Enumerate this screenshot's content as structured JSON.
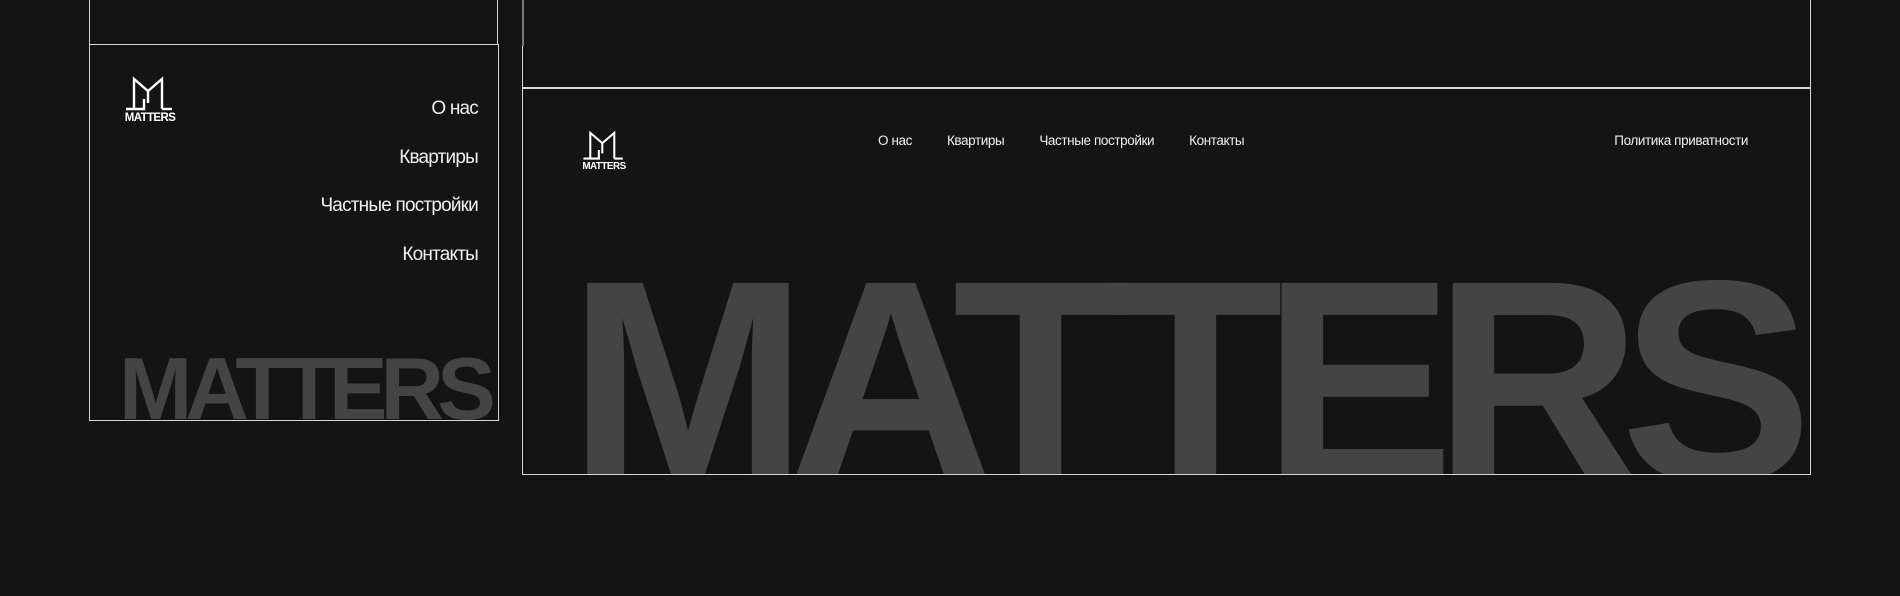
{
  "brand": {
    "logo_text": "MATTERS",
    "wordmark": "MATTERS"
  },
  "mobile": {
    "nav": [
      {
        "label": "О нас"
      },
      {
        "label": "Квартиры"
      },
      {
        "label": "Частные постройки"
      },
      {
        "label": "Контакты"
      }
    ]
  },
  "desktop": {
    "nav": [
      {
        "label": "О нас"
      },
      {
        "label": "Квартиры"
      },
      {
        "label": "Частные постройки"
      },
      {
        "label": "Контакты"
      }
    ],
    "privacy_label": "Политика приватности"
  },
  "colors": {
    "background": "#141414",
    "frame_border": "#d6d6d6",
    "wordmark": "#444444",
    "text": "#f0f0f0"
  },
  "icons": {
    "logo": "matters-logo-icon"
  }
}
